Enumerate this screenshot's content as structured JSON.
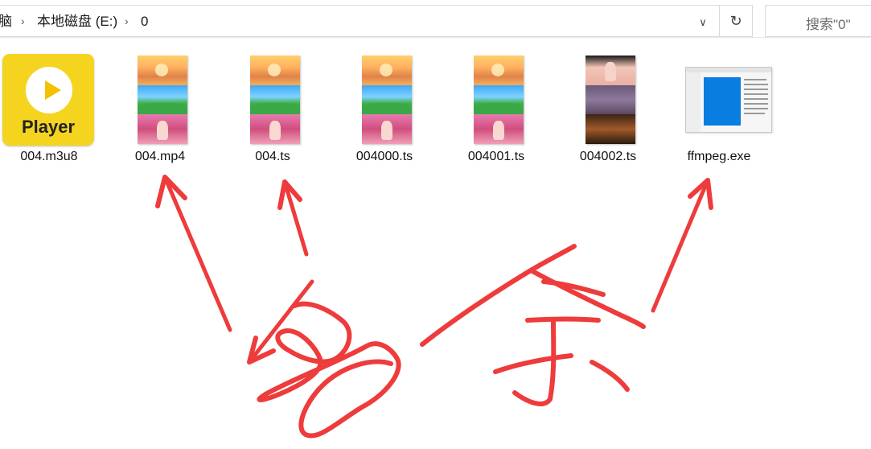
{
  "address_bar": {
    "crumbs": [
      "脑",
      "本地磁盘 (E:)",
      "0"
    ],
    "dropdown_icon": "chevron-down-icon",
    "refresh_icon": "refresh-icon"
  },
  "search": {
    "text": "搜索\"0\""
  },
  "files": [
    {
      "name": "004.m3u8",
      "icon": "player-icon",
      "thumb_text": "Player"
    },
    {
      "name": "004.mp4",
      "icon": "video-thumbnail"
    },
    {
      "name": "004.ts",
      "icon": "video-thumbnail"
    },
    {
      "name": "004000.ts",
      "icon": "video-thumbnail"
    },
    {
      "name": "004001.ts",
      "icon": "video-thumbnail"
    },
    {
      "name": "004002.ts",
      "icon": "video-thumbnail"
    },
    {
      "name": "ffmpeg.exe",
      "icon": "application-icon"
    }
  ],
  "annotation": {
    "text": "多余",
    "color": "#ee3b3b"
  }
}
